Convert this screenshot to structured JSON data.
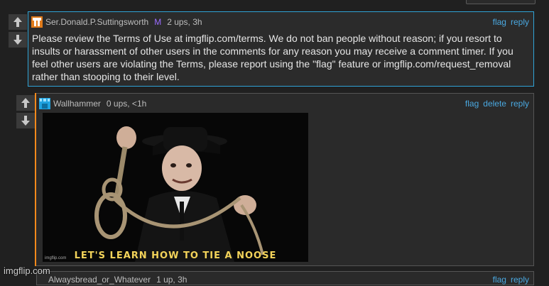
{
  "comments": [
    {
      "username": "Ser.Donald.P.Suttingsworth",
      "badge": "M",
      "meta": "2 ups, 3h",
      "actions": [
        "flag",
        "reply"
      ],
      "text": "Please review the Terms of Use at imgflip.com/terms. We do not ban people without reason; if you resort to insults or harassment of other users in the comments for any reason you may receive a comment timer. If you feel other users are violating the Terms, please report using the \"flag\" feature or imgflip.com/request_removal rather than stooping to their level."
    },
    {
      "username": "Wallhammer",
      "meta": "0 ups, <1h",
      "actions": [
        "flag",
        "delete",
        "reply"
      ],
      "image_caption": "LET'S LEARN HOW TO TIE A NOOSE",
      "image_watermark": "imgflip.com"
    },
    {
      "username": "Alwaysbread_or_Whatever",
      "meta": "1 up, 3h",
      "actions": [
        "flag",
        "reply"
      ]
    }
  ],
  "site_watermark": "imgflip.com",
  "colors": {
    "accent_link": "#4aa8e0",
    "highlight_border": "#2fa3d6",
    "reply_bar": "#f5891b",
    "mod_badge": "#9b6cff",
    "caption": "#f3d35a"
  }
}
